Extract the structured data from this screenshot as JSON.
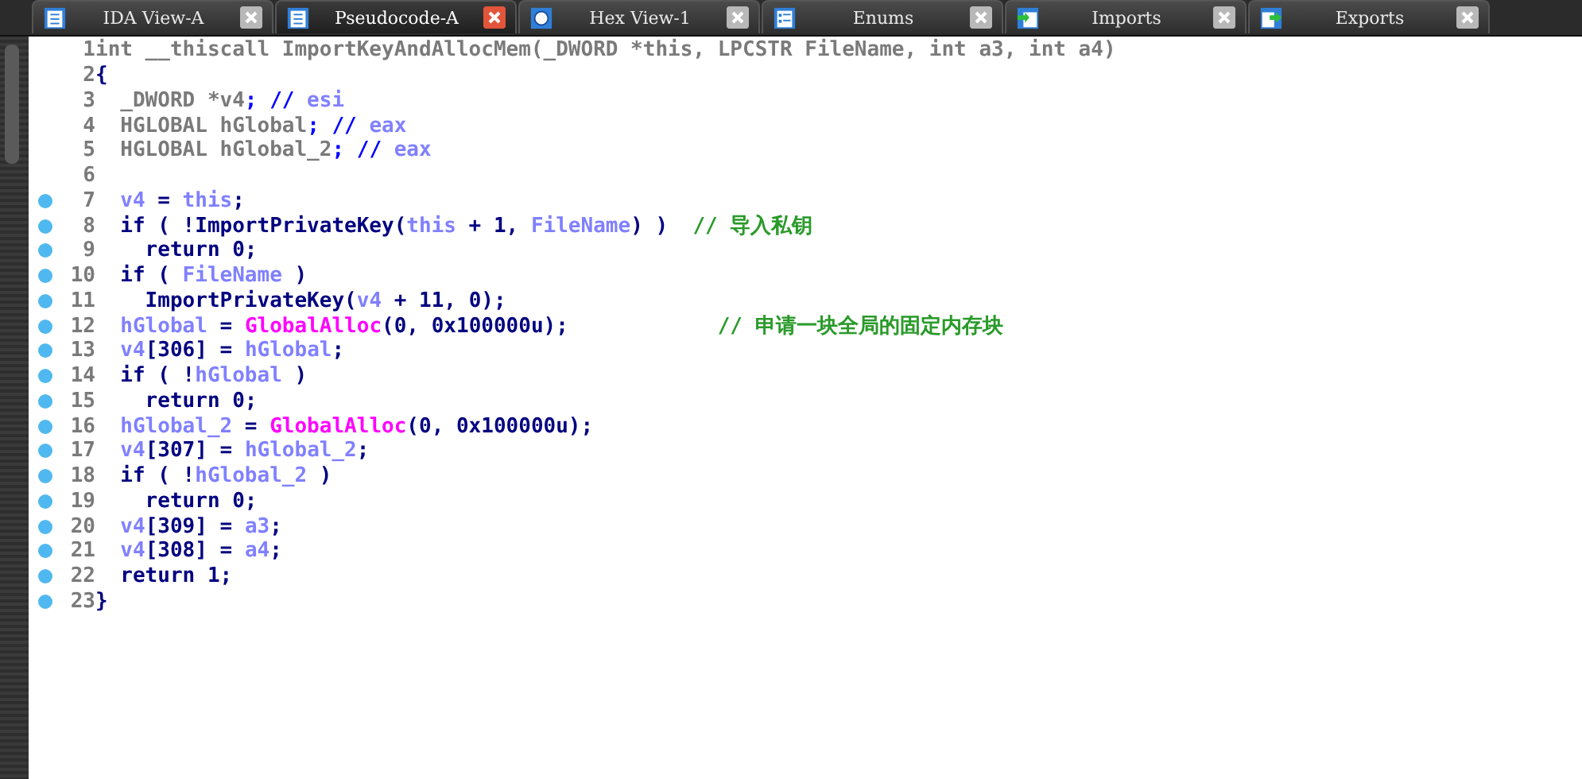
{
  "tabs": [
    {
      "label": "IDA View-A",
      "selected": false,
      "kind": "doc"
    },
    {
      "label": "Pseudocode-A",
      "selected": true,
      "kind": "doc"
    },
    {
      "label": "Hex View-1",
      "selected": false,
      "kind": "hex"
    },
    {
      "label": "Enums",
      "selected": false,
      "kind": "list"
    },
    {
      "label": "Imports",
      "selected": false,
      "kind": "import"
    },
    {
      "label": "Exports",
      "selected": false,
      "kind": "export"
    }
  ],
  "code": [
    {
      "number": "1",
      "marker": false,
      "tokens": [
        {
          "text": "int __thiscall ImportKeyAndAllocMem(_DWORD *this, LPCSTR FileName, int a3, int a4)",
          "kind": "plain"
        }
      ]
    },
    {
      "number": "2",
      "marker": false,
      "tokens": [
        {
          "text": "{",
          "kind": "kw"
        }
      ]
    },
    {
      "number": "3",
      "marker": false,
      "tokens": [
        {
          "text": "  _DWORD *v4",
          "kind": "plain"
        },
        {
          "text": "; //",
          "kind": "kw2"
        },
        {
          "text": " esi",
          "kind": "var"
        }
      ]
    },
    {
      "number": "4",
      "marker": false,
      "tokens": [
        {
          "text": "  HGLOBAL hGlobal",
          "kind": "plain"
        },
        {
          "text": "; //",
          "kind": "kw2"
        },
        {
          "text": " eax",
          "kind": "var"
        }
      ]
    },
    {
      "number": "5",
      "marker": false,
      "tokens": [
        {
          "text": "  HGLOBAL hGlobal_2",
          "kind": "plain"
        },
        {
          "text": "; //",
          "kind": "kw2"
        },
        {
          "text": " eax",
          "kind": "var"
        }
      ]
    },
    {
      "number": "6",
      "marker": false
    },
    {
      "number": "7",
      "marker": true,
      "tokens": [
        {
          "text": "  v4",
          "kind": "var"
        },
        {
          "text": " = ",
          "kind": "kw"
        },
        {
          "text": "this",
          "kind": "var"
        },
        {
          "text": ";",
          "kind": "kw"
        }
      ]
    },
    {
      "number": "8",
      "marker": true,
      "tokens": [
        {
          "text": "  if ( !ImportPrivateKey(",
          "kind": "kw"
        },
        {
          "text": "this",
          "kind": "var"
        },
        {
          "text": " + 1, ",
          "kind": "kw"
        },
        {
          "text": "FileName",
          "kind": "var"
        },
        {
          "text": ") )  ",
          "kind": "kw"
        },
        {
          "text": "// 导入私钥",
          "kind": "comment"
        }
      ]
    },
    {
      "number": "9",
      "marker": true,
      "tokens": [
        {
          "text": "    return 0;",
          "kind": "kw"
        }
      ]
    },
    {
      "number": "10",
      "marker": true,
      "tokens": [
        {
          "text": "  if ( ",
          "kind": "kw"
        },
        {
          "text": "FileName",
          "kind": "var"
        },
        {
          "text": " )",
          "kind": "kw"
        }
      ]
    },
    {
      "number": "11",
      "marker": true,
      "tokens": [
        {
          "text": "    ImportPrivateKey(",
          "kind": "kw"
        },
        {
          "text": "v4",
          "kind": "var"
        },
        {
          "text": " + 11, 0);",
          "kind": "kw"
        }
      ]
    },
    {
      "number": "12",
      "marker": true,
      "tokens": [
        {
          "text": "  hGlobal",
          "kind": "var"
        },
        {
          "text": " = ",
          "kind": "kw"
        },
        {
          "text": "GlobalAlloc",
          "kind": "lib"
        },
        {
          "text": "(0, 0x100000u);            ",
          "kind": "kw"
        },
        {
          "text": "// 申请一块全局的固定内存块",
          "kind": "comment"
        }
      ]
    },
    {
      "number": "13",
      "marker": true,
      "tokens": [
        {
          "text": "  v4",
          "kind": "var"
        },
        {
          "text": "[306] = ",
          "kind": "kw"
        },
        {
          "text": "hGlobal",
          "kind": "var"
        },
        {
          "text": ";",
          "kind": "kw"
        }
      ]
    },
    {
      "number": "14",
      "marker": true,
      "tokens": [
        {
          "text": "  if ( !",
          "kind": "kw"
        },
        {
          "text": "hGlobal",
          "kind": "var"
        },
        {
          "text": " )",
          "kind": "kw"
        }
      ]
    },
    {
      "number": "15",
      "marker": true,
      "tokens": [
        {
          "text": "    return 0;",
          "kind": "kw"
        }
      ]
    },
    {
      "number": "16",
      "marker": true,
      "tokens": [
        {
          "text": "  hGlobal_2",
          "kind": "var"
        },
        {
          "text": " = ",
          "kind": "kw"
        },
        {
          "text": "GlobalAlloc",
          "kind": "lib"
        },
        {
          "text": "(0, 0x100000u);",
          "kind": "kw"
        }
      ]
    },
    {
      "number": "17",
      "marker": true,
      "tokens": [
        {
          "text": "  v4",
          "kind": "var"
        },
        {
          "text": "[307] = ",
          "kind": "kw"
        },
        {
          "text": "hGlobal_2",
          "kind": "var"
        },
        {
          "text": ";",
          "kind": "kw"
        }
      ]
    },
    {
      "number": "18",
      "marker": true,
      "tokens": [
        {
          "text": "  if ( !",
          "kind": "kw"
        },
        {
          "text": "hGlobal_2",
          "kind": "var"
        },
        {
          "text": " )",
          "kind": "kw"
        }
      ]
    },
    {
      "number": "19",
      "marker": true,
      "tokens": [
        {
          "text": "    return 0;",
          "kind": "kw"
        }
      ]
    },
    {
      "number": "20",
      "marker": true,
      "tokens": [
        {
          "text": "  v4",
          "kind": "var"
        },
        {
          "text": "[309] = ",
          "kind": "kw"
        },
        {
          "text": "a3",
          "kind": "var"
        },
        {
          "text": ";",
          "kind": "kw"
        }
      ]
    },
    {
      "number": "21",
      "marker": true,
      "tokens": [
        {
          "text": "  v4",
          "kind": "var"
        },
        {
          "text": "[308] = ",
          "kind": "kw"
        },
        {
          "text": "a4",
          "kind": "var"
        },
        {
          "text": ";",
          "kind": "kw"
        }
      ]
    },
    {
      "number": "22",
      "marker": true,
      "tokens": [
        {
          "text": "  return 1;",
          "kind": "kw"
        }
      ]
    },
    {
      "number": "23",
      "marker": true,
      "tokens": [
        {
          "text": "}",
          "kind": "kw"
        }
      ]
    }
  ]
}
